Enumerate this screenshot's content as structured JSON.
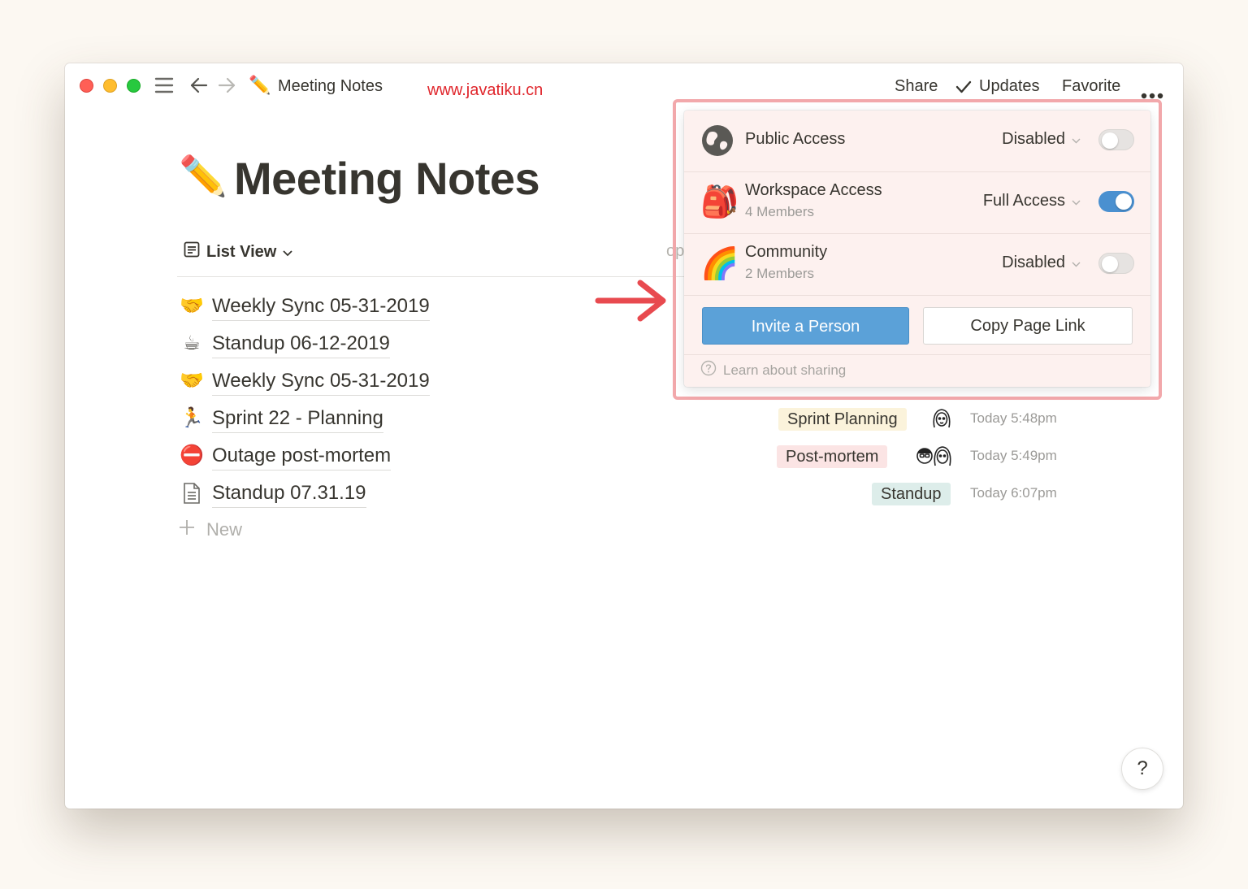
{
  "titlebar": {
    "breadcrumb_emoji": "✏️",
    "breadcrumb": "Meeting Notes",
    "watermark": "www.javatiku.cn",
    "share": "Share",
    "updates": "Updates",
    "favorite": "Favorite"
  },
  "page": {
    "emoji": "✏️",
    "title": "Meeting Notes",
    "view_label": "List View",
    "partially_hidden_text": "op"
  },
  "rows": [
    {
      "emoji": "🤝",
      "title": "Weekly Sync 05-31-2019"
    },
    {
      "emoji": "☕",
      "title": "Standup 06-12-2019"
    },
    {
      "emoji": "🤝",
      "title": "Weekly Sync 05-31-2019"
    },
    {
      "emoji": "🏃",
      "title": "Sprint 22 - Planning",
      "tag": "Sprint Planning",
      "tag_color": "#fbf3db",
      "time": "Today 5:48pm"
    },
    {
      "emoji": "⛔",
      "title": "Outage post-mortem",
      "tag": "Post-mortem",
      "tag_color": "#fbe4e4",
      "time": "Today 5:49pm"
    },
    {
      "emoji": "doc-icon",
      "title": "Standup 07.31.19",
      "tag": "Standup",
      "tag_color": "#ddedea",
      "time": "Today 6:07pm"
    }
  ],
  "new_label": "New",
  "help_label": "?",
  "share_panel": {
    "public": {
      "label": "Public Access",
      "value": "Disabled",
      "enabled": false,
      "icon": "globe-icon"
    },
    "workspace": {
      "label": "Workspace Access",
      "members": "4 Members",
      "value": "Full Access",
      "enabled": true,
      "icon": "🎒"
    },
    "community": {
      "label": "Community",
      "members": "2 Members",
      "value": "Disabled",
      "enabled": false,
      "icon": "🌈"
    },
    "invite_label": "Invite a Person",
    "copy_label": "Copy Page Link",
    "learn_label": "Learn about sharing"
  },
  "colors": {
    "accent_blue": "#5ba1d8",
    "toggle_on": "#4a90d0",
    "highlight": "#f2a8ab",
    "arrow": "#e84a4f"
  }
}
